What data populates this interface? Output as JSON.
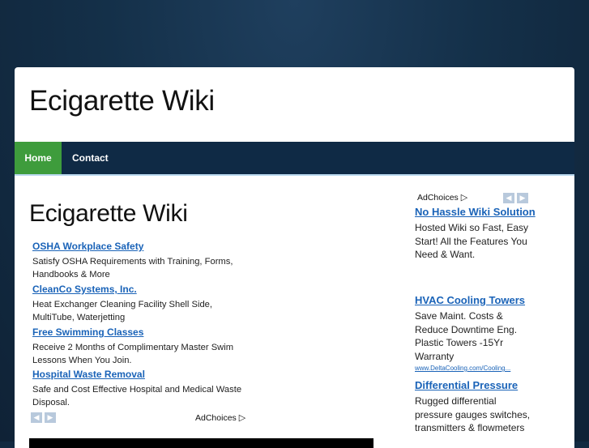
{
  "site": {
    "title": "Ecigarette Wiki"
  },
  "nav": {
    "home": "Home",
    "contact": "Contact"
  },
  "main": {
    "title": "Ecigarette Wiki",
    "ads": [
      {
        "title": "OSHA Workplace Safety",
        "desc": "Satisfy OSHA Requirements with Training, Forms, Handbooks & More"
      },
      {
        "title": "CleanCo Systems, Inc.",
        "desc": "Heat Exchanger Cleaning Facility Shell Side, MultiTube, Waterjetting"
      },
      {
        "title": "Free Swimming Classes",
        "desc": "Receive 2 Months of Complimentary Master Swim Lessons When You Join."
      },
      {
        "title": "Hospital Waste Removal",
        "desc": "Safe and Cost Effective Hospital and Medical Waste Disposal."
      }
    ],
    "adchoices": "AdChoices"
  },
  "sidebar": {
    "adchoices": "AdChoices",
    "ads": [
      {
        "title": "No Hassle Wiki Solution",
        "desc": "Hosted Wiki so Fast, Easy Start! All the Features You Need & Want."
      },
      {
        "title": "HVAC Cooling Towers",
        "desc": "Save Maint. Costs & Reduce Downtime Eng. Plastic Towers -15Yr Warranty",
        "url": "www.DeltaCooling.com/Cooling..."
      },
      {
        "title": "Differential Pressure",
        "desc": "Rugged differential pressure gauges switches, transmitters & flowmeters"
      }
    ]
  },
  "icons": {
    "prev": "chevron-left-icon",
    "next": "chevron-right-icon",
    "adchoices": "adchoices-triangle-icon"
  },
  "colors": {
    "nav_bg": "#0f2a45",
    "nav_active": "#3e9c3c",
    "link": "#1a63b8"
  }
}
